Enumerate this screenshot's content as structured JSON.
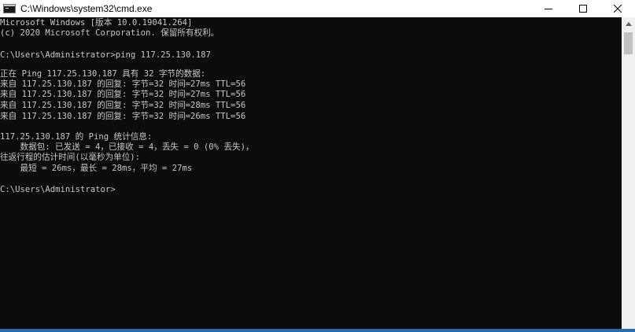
{
  "window": {
    "title": "C:\\Windows\\system32\\cmd.exe",
    "icon": "cmd-console-icon",
    "controls": {
      "minimize": "minimize-icon",
      "maximize": "maximize-icon",
      "close": "close-icon"
    }
  },
  "console": {
    "lines": [
      "Microsoft Windows [版本 10.0.19041.264]",
      "(c) 2020 Microsoft Corporation. 保留所有权利。",
      "",
      "C:\\Users\\Administrator>ping 117.25.130.187",
      "",
      "正在 Ping 117.25.130.187 具有 32 字节的数据:",
      "来自 117.25.130.187 的回复: 字节=32 时间=27ms TTL=56",
      "来自 117.25.130.187 的回复: 字节=32 时间=27ms TTL=56",
      "来自 117.25.130.187 的回复: 字节=32 时间=28ms TTL=56",
      "来自 117.25.130.187 的回复: 字节=32 时间=26ms TTL=56",
      "",
      "117.25.130.187 的 Ping 统计信息:",
      "    数据包: 已发送 = 4，已接收 = 4，丢失 = 0 (0% 丢失)，",
      "往返行程的估计时间(以毫秒为单位):",
      "    最短 = 26ms，最长 = 28ms，平均 = 27ms",
      "",
      "C:\\Users\\Administrator>"
    ]
  },
  "colors": {
    "background": "#0c0c0c",
    "text": "#c7c7c7",
    "titlebar": "#ffffff",
    "accent": "#1f6fbf"
  }
}
